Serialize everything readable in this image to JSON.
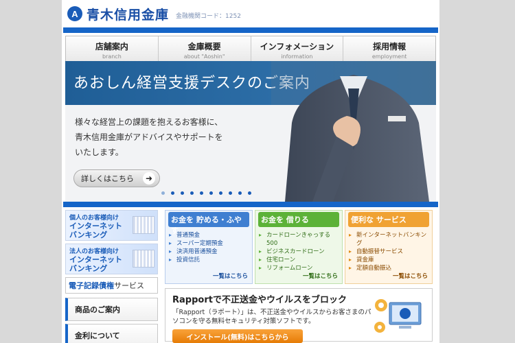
{
  "header": {
    "logo_mark": "A",
    "bank_name": "青木信用金庫",
    "bank_code": "金融機関コード：1252"
  },
  "nav": [
    {
      "jp": "店舗案内",
      "en": "branch"
    },
    {
      "jp": "金庫概要",
      "en": "about \"Aoshin\""
    },
    {
      "jp": "インフォメーション",
      "en": "information"
    },
    {
      "jp": "採用情報",
      "en": "employment"
    }
  ],
  "hero": {
    "title": "あおしん経営支援デスクのご案内",
    "body": [
      "様々な経営上の課題を抱えるお客様に、",
      "青木信用金庫がアドバイスやサポートを",
      "いたします。"
    ],
    "button_label": "詳しくはこちら",
    "slide_count": 10,
    "active_slide": 0
  },
  "sidebar": {
    "personal_banking": {
      "small": "個人のお客様向け",
      "line1": "インターネット",
      "line2": "バンキング"
    },
    "corporate_banking": {
      "small": "法人のお客様向け",
      "line1": "インターネット",
      "line2": "バンキング"
    },
    "denshi": {
      "highlight": "電子記録債権",
      "rest": "サービス"
    },
    "menu": [
      "商品のご案内",
      "金利について"
    ]
  },
  "cards": [
    {
      "head": "お金を 貯める・ふやす",
      "items": [
        "普通預金",
        "スーパー定期預金",
        "決済用普通預金",
        "投資信託"
      ],
      "more": "一覧はこちら"
    },
    {
      "head": "お金を 借りる",
      "items": [
        "カードローンきゃっする500",
        "ビジネスカードローン",
        "住宅ローン",
        "リフォームローン"
      ],
      "more": "一覧はこちら"
    },
    {
      "head": "便利な サービス",
      "items": [
        "新インターネットバンキング",
        "自動振替サービス",
        "貸金庫",
        "定額自動振込"
      ],
      "more": "一覧はこちら"
    }
  ],
  "promo": {
    "title": "Rapportで不正送金やウイルスをブロック",
    "body": "「Rapport（ラポート）」は、不正送金やウイルスからお客さまのパソコンを守る無料セキュリティ対策ソフトです。",
    "button_label": "インストール(無料)はこちらから"
  },
  "colors": {
    "primary": "#1565c8",
    "green": "#5cb238",
    "orange": "#f0a233"
  }
}
